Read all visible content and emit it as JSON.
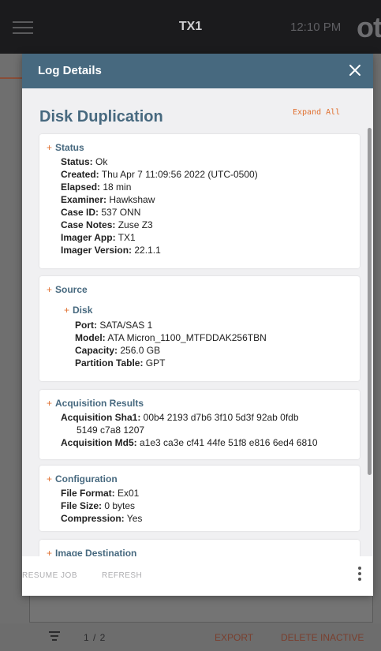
{
  "app": {
    "title": "TX1",
    "time": "12:10 PM",
    "logo": "ot",
    "footer": {
      "page": "1 / 2",
      "export": "EXPORT",
      "delete_inactive": "DELETE INACTIVE"
    }
  },
  "modal": {
    "title": "Log Details",
    "section_title": "Disk Duplication",
    "expand_all": "Expand All",
    "status": {
      "heading": "Status",
      "fields": [
        {
          "label": "Status:",
          "value": " Ok"
        },
        {
          "label": "Created:",
          "value": " Thu Apr 7 11:09:56 2022 (UTC-0500)"
        },
        {
          "label": "Elapsed:",
          "value": " 18 min"
        },
        {
          "label": "Examiner:",
          "value": " Hawkshaw"
        },
        {
          "label": "Case ID:",
          "value": " 537 ONN"
        },
        {
          "label": "Case Notes:",
          "value": " Zuse Z3"
        },
        {
          "label": "Imager App:",
          "value": " TX1"
        },
        {
          "label": "Imager Version:",
          "value": " 22.1.1"
        }
      ]
    },
    "source": {
      "heading": "Source",
      "disk": {
        "heading": "Disk",
        "fields": [
          {
            "label": "Port:",
            "value": " SATA/SAS 1"
          },
          {
            "label": "Model:",
            "value": " ATA Micron_1100_MTFDDAK256TBN"
          },
          {
            "label": "Capacity:",
            "value": " 256.0 GB"
          },
          {
            "label": "Partition Table:",
            "value": " GPT"
          }
        ]
      }
    },
    "acquisition": {
      "heading": "Acquisition Results",
      "sha1_label": "Acquisition Sha1:",
      "sha1_value_line1": " 00b4 2193 d7b6 3f10 5d3f 92ab 0fdb",
      "sha1_value_line2": "5149 c7a8 1207",
      "md5_label": "Acquisition Md5:",
      "md5_value": " a1e3 ca3e cf41 44fe 51f8 e816 6ed4 6810"
    },
    "configuration": {
      "heading": "Configuration",
      "fields": [
        {
          "label": "File Format:",
          "value": " Ex01"
        },
        {
          "label": "File Size:",
          "value": " 0 bytes"
        },
        {
          "label": "Compression:",
          "value": " Yes"
        }
      ]
    },
    "image_destination": {
      "heading": "Image Destination"
    },
    "footer": {
      "resume_job": "RESUME JOB",
      "refresh": "REFRESH"
    }
  }
}
